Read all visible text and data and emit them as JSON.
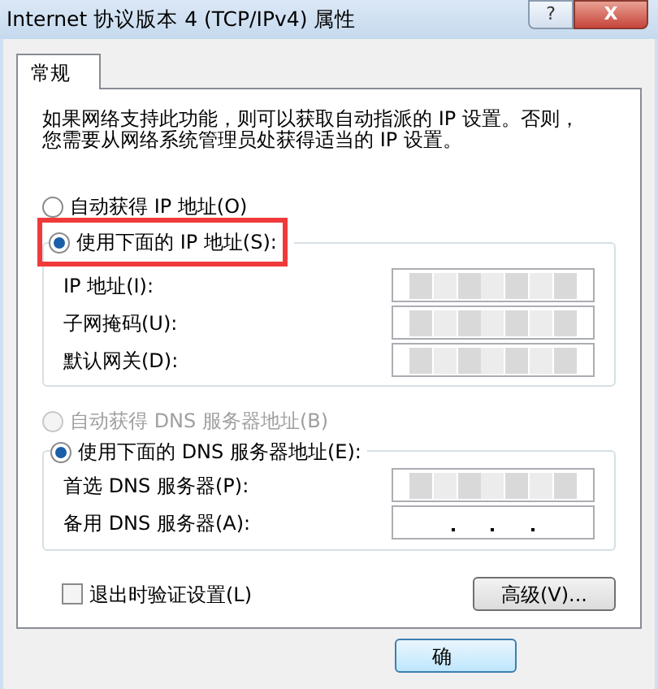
{
  "window": {
    "title": "Internet 协议版本 4 (TCP/IPv4) 属性",
    "buttons": [
      "?",
      "X"
    ]
  },
  "tabs": [
    {
      "label": "常规",
      "selected": true
    }
  ],
  "description": "如果网络支持此功能，则可以获取自动指派的 IP 设置。否则，您需要从网络系统管理员处获得适当的 IP 设置。",
  "ip_options": [
    {
      "label": "自动获得 IP 地址(O)",
      "selected": false,
      "disabled": false,
      "highlighted": false
    },
    {
      "label": "使用下面的 IP 地址(S):",
      "selected": true,
      "disabled": false,
      "highlighted": true
    }
  ],
  "ip_fields": [
    {
      "label": "IP 地址(I):",
      "kind": "redacted"
    },
    {
      "label": "子网掩码(U):",
      "kind": "redacted"
    },
    {
      "label": "默认网关(D):",
      "kind": "redacted"
    }
  ],
  "dns_options": [
    {
      "label": "自动获得 DNS 服务器地址(B)",
      "selected": false,
      "disabled": true,
      "highlighted": false
    },
    {
      "label": "使用下面的 DNS 服务器地址(E):",
      "selected": true,
      "disabled": false,
      "highlighted": false
    }
  ],
  "dns_fields": [
    {
      "label": "首选 DNS 服务器(P):",
      "kind": "redacted"
    },
    {
      "label": "备用 DNS 服务器(A):",
      "kind": "empty"
    }
  ],
  "validate_checkbox": {
    "label": "退出时验证设置(L)",
    "checked": false
  },
  "advanced_button": "高级(V)...",
  "ok_button": "确"
}
